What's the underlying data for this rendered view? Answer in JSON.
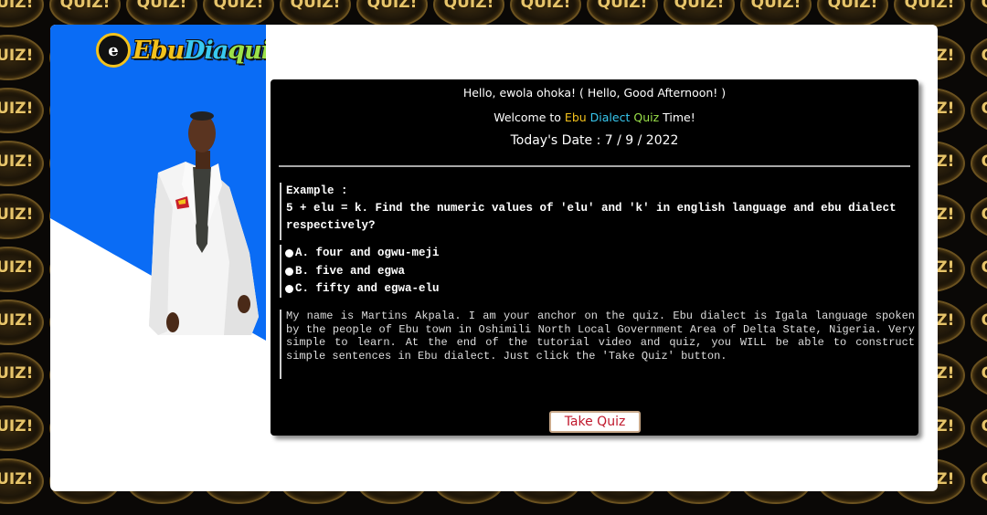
{
  "background_badge_text": "QUIZ!",
  "logo": {
    "circle_letter": "e",
    "part1": "Ebu",
    "part2": "Dia",
    "part3": "quiz"
  },
  "header": {
    "greeting": "Hello, ewola ohoka! ( Hello, Good Afternoon! )",
    "welcome_prefix": "Welcome to",
    "welcome_ebu": "Ebu",
    "welcome_dialect": "Dialect",
    "welcome_quiz": "Quiz",
    "welcome_suffix": "Time!",
    "date": "Today's Date : 7 / 9 / 2022"
  },
  "question": {
    "label": "Example :",
    "text": "5 + elu = k. Find the numeric values of 'elu' and 'k' in english language and ebu dialect respectively?",
    "options": [
      {
        "label": "A. four and ogwu-meji"
      },
      {
        "label": "B. five and egwa"
      },
      {
        "label": "C. fifty and egwa-elu"
      }
    ]
  },
  "about_text": "My name is Martins Akpala. I am your anchor on the quiz. Ebu dialect is Igala language spoken by the people of Ebu town in Oshimili North Local Government Area of Delta State, Nigeria. Very simple to learn. At the end of the tutorial video and quiz, you WILL be able to construct simple sentences in Ebu dialect. Just click the 'Take Quiz' button.",
  "take_quiz_label": "Take Quiz",
  "colors": {
    "ebu": "#f3c21c",
    "dialect": "#38c9f0",
    "quiz": "#9be24a",
    "button_text": "#c0182c",
    "left_blue": "#0a6cf5"
  }
}
